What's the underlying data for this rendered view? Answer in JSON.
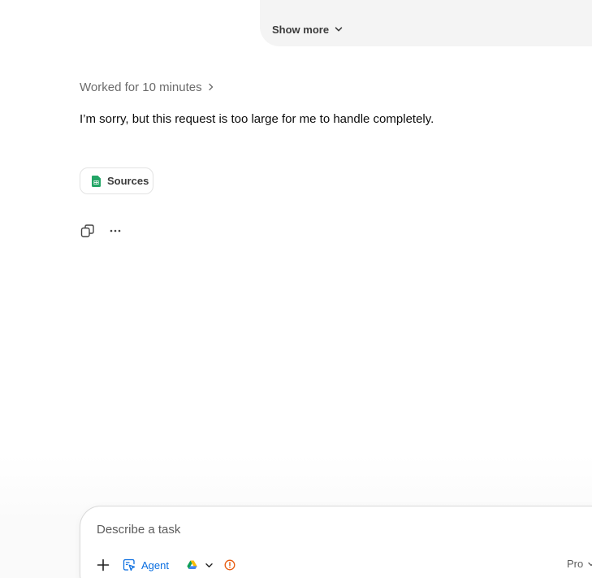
{
  "user_message": {
    "show_more_label": "Show more"
  },
  "assistant": {
    "worked_for_label": "Worked for 10 minutes",
    "response_text": "I’m sorry, but this request is too large for me to handle completely.",
    "sources_label": "Sources"
  },
  "composer": {
    "placeholder": "Describe a task",
    "agent_label": "Agent",
    "model_label": "Pro"
  },
  "colors": {
    "accent_blue": "#0a6ee0",
    "sheets_green": "#23a566",
    "warning_orange": "#e8590c",
    "bubble_bg": "#f4f4f4"
  },
  "icons": {
    "show_more": "chevron-down-icon",
    "worked_for": "chevron-right-icon",
    "sources": "spreadsheet-icon",
    "copy": "copy-icon",
    "more": "ellipsis-icon",
    "plus": "plus-icon",
    "agent": "agent-cursor-icon",
    "drive": "google-drive-icon",
    "warning": "warning-circle-icon"
  }
}
